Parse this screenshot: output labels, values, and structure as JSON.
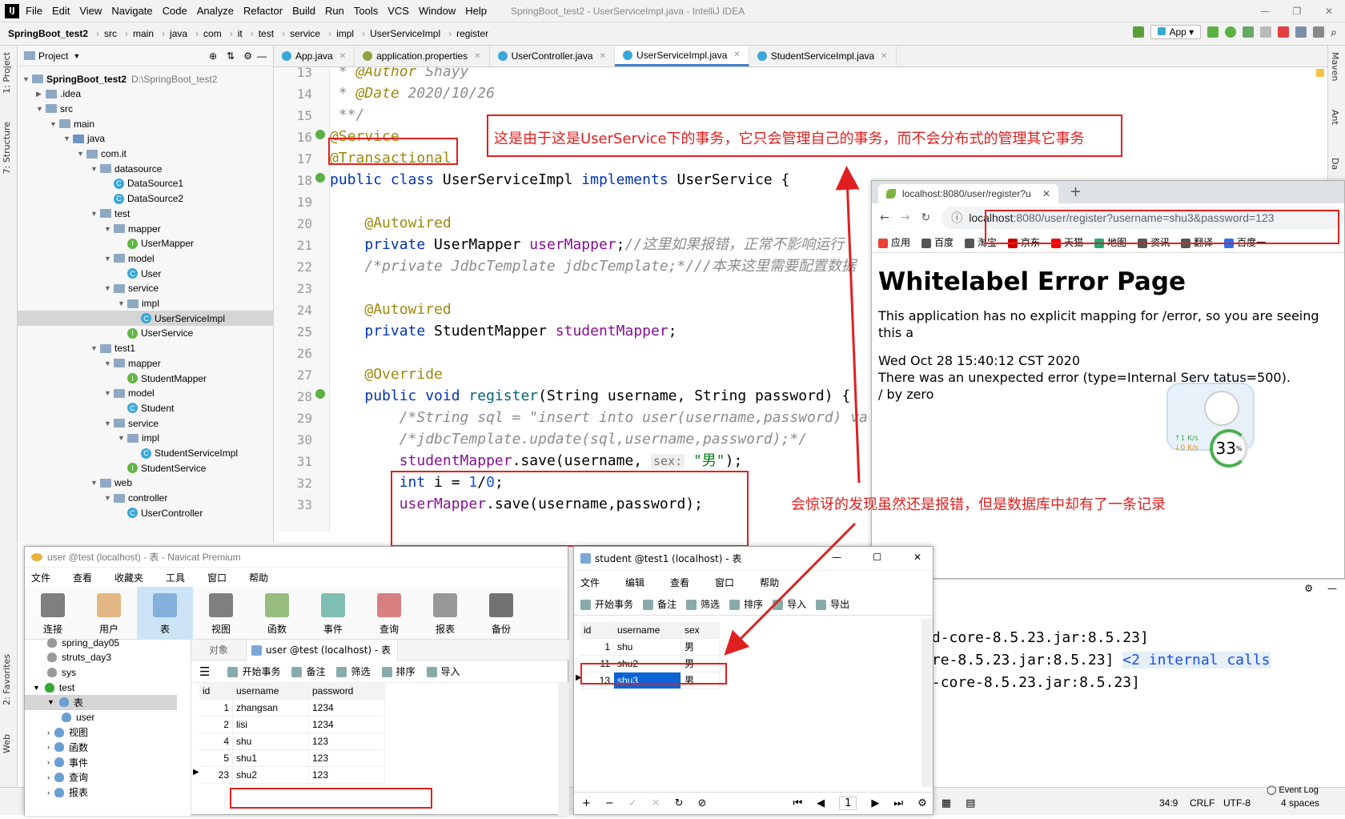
{
  "ide": {
    "menu": [
      "File",
      "Edit",
      "View",
      "Navigate",
      "Code",
      "Analyze",
      "Refactor",
      "Build",
      "Run",
      "Tools",
      "VCS",
      "Window",
      "Help"
    ],
    "window_title": "SpringBoot_test2 - UserServiceImpl.java - IntelliJ IDEA",
    "breadcrumb": [
      "SpringBoot_test2",
      "src",
      "main",
      "java",
      "com",
      "it",
      "test",
      "service",
      "impl",
      "UserServiceImpl",
      "register"
    ],
    "run_config": "App",
    "left_tabs": [
      "1: Project",
      "7: Structure",
      "2: Favorites",
      "Web"
    ],
    "right_tabs": [
      "Maven",
      "Ant",
      "Da"
    ],
    "project_label": "Project",
    "tree": [
      {
        "label": "SpringBoot_test2",
        "extra": "D:\\SpringBoot_test2",
        "depth": 0,
        "kind": "root"
      },
      {
        "label": ".idea",
        "depth": 1,
        "kind": "folder"
      },
      {
        "label": "src",
        "depth": 1,
        "kind": "folder"
      },
      {
        "label": "main",
        "depth": 2,
        "kind": "folder"
      },
      {
        "label": "java",
        "depth": 3,
        "kind": "src"
      },
      {
        "label": "com.it",
        "depth": 4,
        "kind": "folder"
      },
      {
        "label": "datasource",
        "depth": 5,
        "kind": "folder"
      },
      {
        "label": "DataSource1",
        "depth": 6,
        "kind": "class"
      },
      {
        "label": "DataSource2",
        "depth": 6,
        "kind": "class"
      },
      {
        "label": "test",
        "depth": 5,
        "kind": "folder"
      },
      {
        "label": "mapper",
        "depth": 6,
        "kind": "folder"
      },
      {
        "label": "UserMapper",
        "depth": 7,
        "kind": "iface"
      },
      {
        "label": "model",
        "depth": 6,
        "kind": "folder"
      },
      {
        "label": "User",
        "depth": 7,
        "kind": "class"
      },
      {
        "label": "service",
        "depth": 6,
        "kind": "folder"
      },
      {
        "label": "impl",
        "depth": 7,
        "kind": "folder"
      },
      {
        "label": "UserServiceImpl",
        "depth": 8,
        "kind": "class",
        "selected": true
      },
      {
        "label": "UserService",
        "depth": 7,
        "kind": "iface"
      },
      {
        "label": "test1",
        "depth": 5,
        "kind": "folder"
      },
      {
        "label": "mapper",
        "depth": 6,
        "kind": "folder"
      },
      {
        "label": "StudentMapper",
        "depth": 7,
        "kind": "iface"
      },
      {
        "label": "model",
        "depth": 6,
        "kind": "folder"
      },
      {
        "label": "Student",
        "depth": 7,
        "kind": "class"
      },
      {
        "label": "service",
        "depth": 6,
        "kind": "folder"
      },
      {
        "label": "impl",
        "depth": 7,
        "kind": "folder"
      },
      {
        "label": "StudentServiceImpl",
        "depth": 8,
        "kind": "class"
      },
      {
        "label": "StudentService",
        "depth": 7,
        "kind": "iface"
      },
      {
        "label": "web",
        "depth": 5,
        "kind": "folder"
      },
      {
        "label": "controller",
        "depth": 6,
        "kind": "folder"
      },
      {
        "label": "UserController",
        "depth": 7,
        "kind": "class"
      }
    ],
    "tabs": [
      {
        "label": "App.java",
        "color": "#3aa7d8"
      },
      {
        "label": "application.properties",
        "color": "#8da640"
      },
      {
        "label": "UserController.java",
        "color": "#3aa7d8"
      },
      {
        "label": "UserServiceImpl.java",
        "color": "#3aa7d8",
        "active": true
      },
      {
        "label": "StudentServiceImpl.java",
        "color": "#3aa7d8"
      }
    ],
    "code_lines": [
      {
        "n": "13",
        "html": "<span class='cm'> * <span class='an'>@Author</span> Shayy</span>"
      },
      {
        "n": "14",
        "html": "<span class='cm'> * <span class='an'>@Date</span> 2020/10/26</span>"
      },
      {
        "n": "15",
        "html": "<span class='cm'> **/</span>"
      },
      {
        "n": "16",
        "html": "<span class='an'>@Service</span>"
      },
      {
        "n": "17",
        "html": "<span class='an'>@Transactional</span>"
      },
      {
        "n": "18",
        "html": "<span class='kw'>public class</span> UserServiceImpl <span class='kw'>implements</span> UserService {"
      },
      {
        "n": "19",
        "html": ""
      },
      {
        "n": "20",
        "html": "    <span class='an'>@Autowired</span>"
      },
      {
        "n": "21",
        "html": "    <span class='kw'>private</span> UserMapper <span class='fl'>userMapper</span>;<span class='cm'>//这里如果报错，正常不影响运行</span>"
      },
      {
        "n": "22",
        "html": "    <span class='cm'>/*private JdbcTemplate jdbcTemplate;*///本来这里需要配置数据</span>"
      },
      {
        "n": "23",
        "html": ""
      },
      {
        "n": "24",
        "html": "    <span class='an'>@Autowired</span>"
      },
      {
        "n": "25",
        "html": "    <span class='kw'>private</span> StudentMapper <span class='fl'>studentMapper</span>;"
      },
      {
        "n": "26",
        "html": ""
      },
      {
        "n": "27",
        "html": "    <span class='an'>@Override</span>"
      },
      {
        "n": "28",
        "html": "    <span class='kw'>public void</span> <span style='color:#00627a'>register</span>(String username, String password) {"
      },
      {
        "n": "29",
        "html": "        <span class='cm'>/*String sql = \"insert into user(username,password) va</span>"
      },
      {
        "n": "30",
        "html": "        <span class='cm'>/*jdbcTemplate.update(sql,username,password);*/</span>"
      },
      {
        "n": "31",
        "html": "        <span class='fl'>studentMapper</span>.save(username, <span class='hint'>sex:</span> <span class='st'>\"男\"</span>);"
      },
      {
        "n": "32",
        "html": "        <span class='kw'>int</span> i = <span class='nm'>1</span>/<span class='nm'>0</span>;"
      },
      {
        "n": "33",
        "html": "        <span class='fl'>userMapper</span>.save(username,password);"
      }
    ],
    "console_lines": [
      "at-embed-core-8.5.23.jar:8.5.23]",
      "mbed-core-8.5.23.jar:8.5.23] <2 internal calls",
      "t-embed-core-8.5.23.jar:8.5.23]"
    ],
    "event_log": "Event Log",
    "status": {
      "pos": "34:9",
      "eol": "CRLF",
      "enc": "UTF-8",
      "indent": "4 spaces"
    }
  },
  "annotations": {
    "note1": "这是由于这是UserService下的事务，它只会管理自己的事务，而不会分布式的管理其它事务",
    "note2": "会惊讶的发现虽然还是报错，但是数据库中却有了一条记录"
  },
  "browser": {
    "tab_title": "localhost:8080/user/register?u",
    "url_host": "localhost",
    "url_rest": ":8080/user/register?username=shu3&password=123",
    "bookmarks": [
      "应用",
      "百度",
      "淘宝",
      "京东",
      "天猫",
      "地图",
      "资讯",
      "翻译",
      "百度一"
    ],
    "heading": "Whitelabel Error Page",
    "lines": [
      "This application has no explicit mapping for /error, so you are seeing this a",
      "",
      "Wed Oct 28 15:40:12 CST 2020",
      "There was an unexpected error (type=Internal Serv        tatus=500).",
      "/ by zero"
    ],
    "widget": {
      "up": "↑1  K/s",
      "down": "↓0  K/s",
      "pct": "33",
      "unit": "%"
    }
  },
  "navicat": {
    "title": "user @test (localhost) - 表 - Navicat Premium",
    "menu": [
      "文件",
      "查看",
      "收藏夹",
      "工具",
      "窗口",
      "帮助"
    ],
    "tools": [
      "连接",
      "用户",
      "表",
      "视图",
      "函数",
      "事件",
      "查询",
      "报表",
      "备份"
    ],
    "side": [
      {
        "label": "spring_day05",
        "indent": 1
      },
      {
        "label": "struts_day3",
        "indent": 1
      },
      {
        "label": "sys",
        "indent": 1
      },
      {
        "label": "test",
        "indent": 0,
        "open": true
      },
      {
        "label": "表",
        "indent": 1,
        "open": true,
        "sel": true
      },
      {
        "label": "user",
        "indent": 2
      },
      {
        "label": "视图",
        "indent": 1
      },
      {
        "label": "函数",
        "indent": 1
      },
      {
        "label": "事件",
        "indent": 1
      },
      {
        "label": "查询",
        "indent": 1
      },
      {
        "label": "报表",
        "indent": 1
      }
    ],
    "obj_tab": "对象",
    "table_tab": "user @test (localhost) - 表",
    "actions": [
      "开始事务",
      "备注",
      "筛选",
      "排序",
      "导入"
    ],
    "columns": [
      "id",
      "username",
      "password"
    ],
    "rows": [
      [
        "1",
        "zhangsan",
        "1234"
      ],
      [
        "2",
        "lisi",
        "1234"
      ],
      [
        "4",
        "shu",
        "123"
      ],
      [
        "5",
        "shu1",
        "123"
      ],
      [
        "23",
        "shu2",
        "123"
      ]
    ]
  },
  "student": {
    "title": "student @test1 (localhost) - 表",
    "menu": [
      "文件",
      "编辑",
      "查看",
      "窗口",
      "帮助"
    ],
    "actions": [
      "开始事务",
      "备注",
      "筛选",
      "排序",
      "导入",
      "导出"
    ],
    "columns": [
      "id",
      "username",
      "sex"
    ],
    "rows": [
      [
        "1",
        "shu",
        "男"
      ],
      [
        "11",
        "shu2",
        "男"
      ],
      [
        "13",
        "shu3",
        "男"
      ]
    ],
    "page": "1"
  }
}
